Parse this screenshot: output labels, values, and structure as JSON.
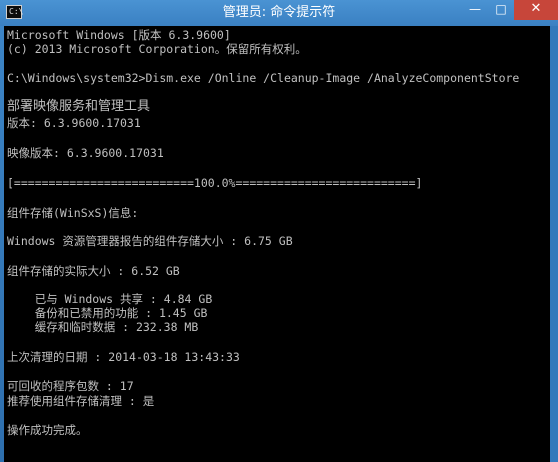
{
  "window": {
    "title": "管理员: 命令提示符",
    "icon_text": "C:\\",
    "minimize_glyph": "—",
    "maximize_glyph": "□",
    "close_glyph": "✕",
    "colors": {
      "frame": "#3a80c2",
      "close": "#c7463a",
      "console_bg": "#000000",
      "console_text": "#c0c0c0"
    }
  },
  "console": {
    "lines": [
      "Microsoft Windows [版本 6.3.9600]",
      "(c) 2013 Microsoft Corporation。保留所有权利。",
      "C:\\Windows\\system32>Dism.exe /Online /Cleanup-Image /AnalyzeComponentStore",
      "部署映像服务和管理工具",
      "版本: 6.3.9600.17031",
      "映像版本: 6.3.9600.17031",
      "[==========================100.0%==========================]",
      "组件存储(WinSxS)信息:",
      "Windows 资源管理器报告的组件存储大小 : 6.75 GB",
      "组件存储的实际大小 : 6.52 GB",
      "    已与 Windows 共享 : 4.84 GB",
      "    备份和已禁用的功能 : 1.45 GB",
      "    缓存和临时数据 : 232.38 MB",
      "上次清理的日期 : 2014-03-18 13:43:33",
      "可回收的程序包数 : 17",
      "推荐使用组件存储清理 : 是",
      "操作成功完成。"
    ]
  }
}
